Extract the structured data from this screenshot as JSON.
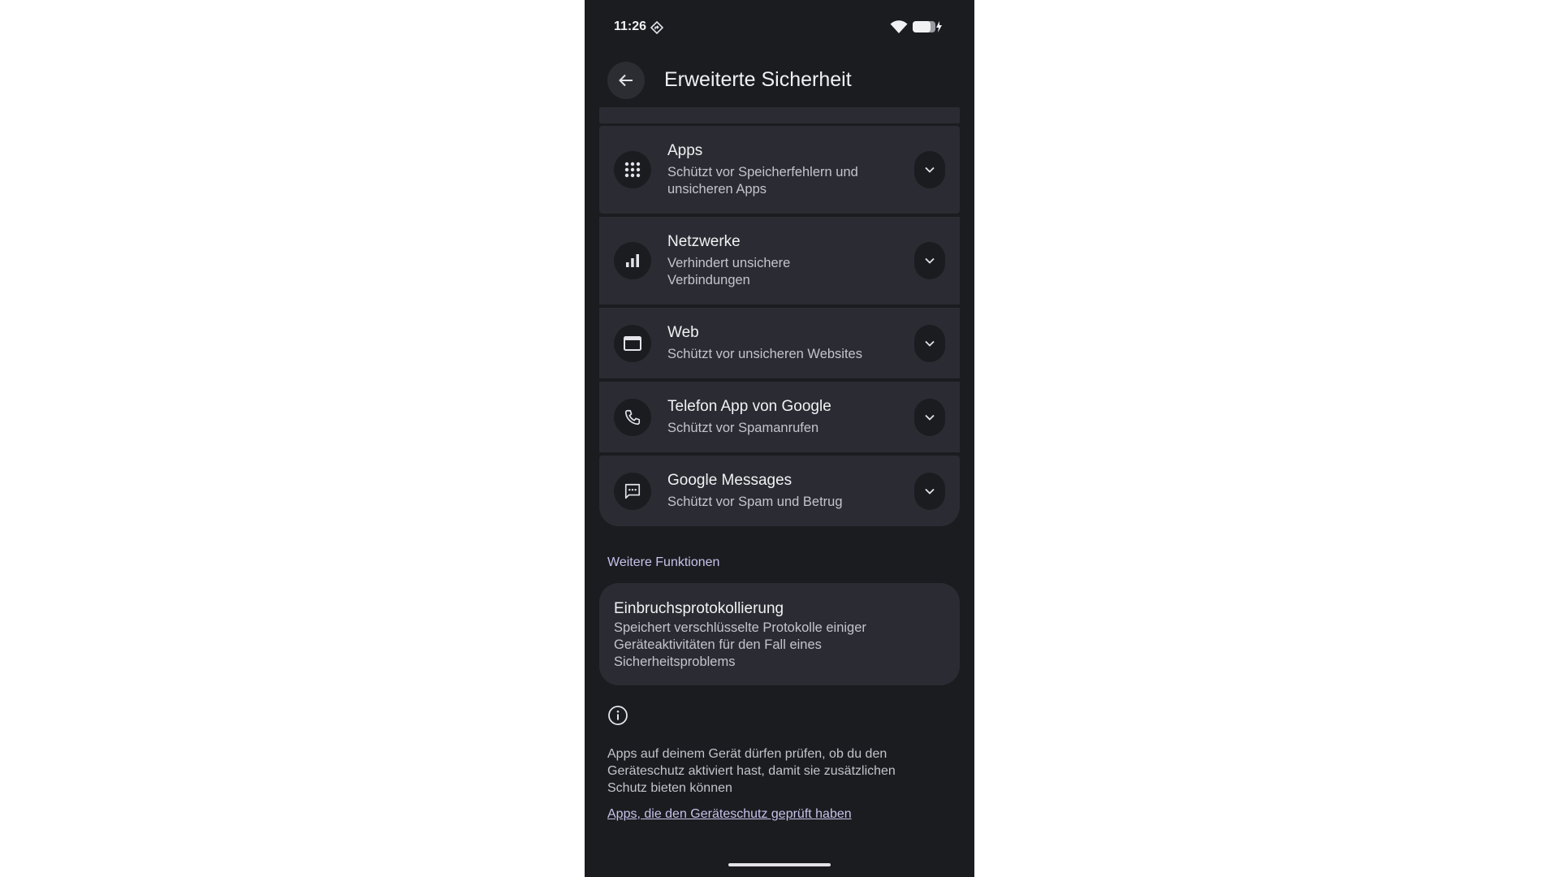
{
  "status_bar": {
    "time": "11:26",
    "indicator_icon": "location-diamond-icon",
    "wifi_icon": "wifi-icon",
    "battery_icon": "battery-charging-icon"
  },
  "header": {
    "back_icon": "arrow-back-icon",
    "title": "Erweiterte Sicherheit"
  },
  "protection_items": [
    {
      "icon": "apps-grid-icon",
      "title": "Apps",
      "subtitle": "Schützt vor Speicherfehlern und unsicheren Apps"
    },
    {
      "icon": "signal-bars-icon",
      "title": "Netzwerke",
      "subtitle": "Verhindert unsichere Verbindungen"
    },
    {
      "icon": "browser-window-icon",
      "title": "Web",
      "subtitle": "Schützt vor unsicheren Websites"
    },
    {
      "icon": "phone-icon",
      "title": "Telefon App von Google",
      "subtitle": "Schützt vor Spamanrufen"
    },
    {
      "icon": "message-icon",
      "title": "Google Messages",
      "subtitle": "Schützt vor Spam und Betrug"
    }
  ],
  "more_features": {
    "heading": "Weitere Funktionen",
    "items": [
      {
        "title": "Einbruchsprotokollierung",
        "description": "Speichert verschlüsselte Protokolle einiger Geräteaktivitäten für den Fall eines Sicherheitsproblems"
      }
    ]
  },
  "footer": {
    "info_icon": "info-icon",
    "text": "Apps auf deinem Gerät dürfen prüfen, ob du den Geräteschutz aktiviert hast, damit sie zusätzlichen Schutz bieten können",
    "link": "Apps, die den Geräteschutz geprüft haben"
  },
  "colors": {
    "background": "#1b1c20",
    "surface": "#2b2c33",
    "accent": "#c5c3ea",
    "text_primary": "#f1f1f4",
    "text_secondary": "#c3c4cc"
  }
}
